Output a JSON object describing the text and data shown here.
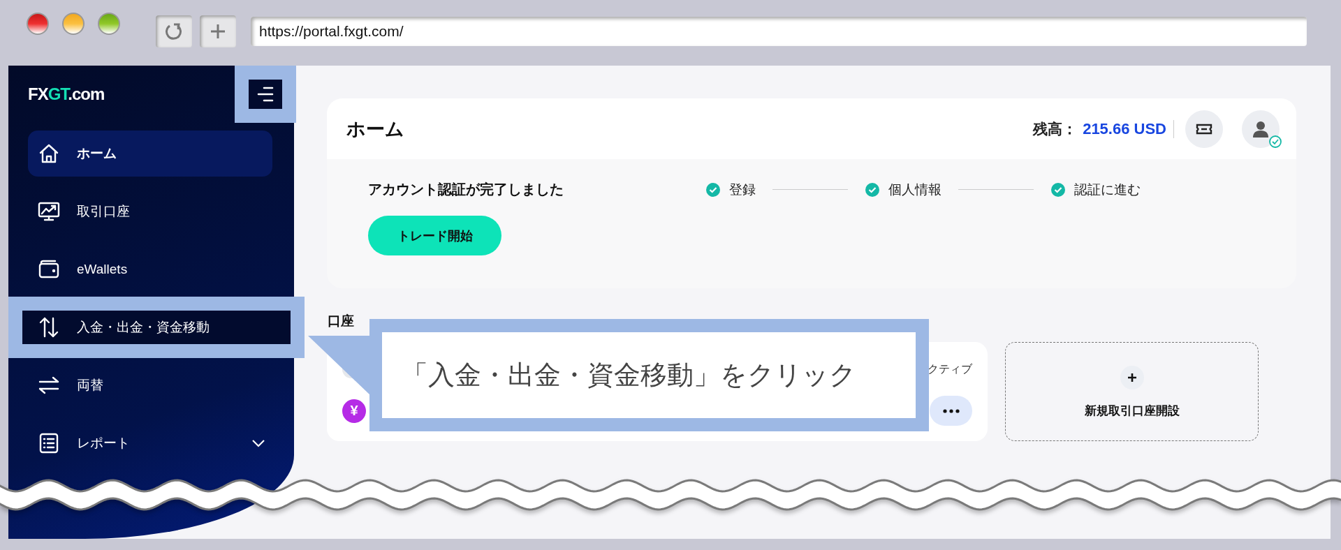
{
  "browser": {
    "url": "https://portal.fxgt.com/"
  },
  "sidebar": {
    "logo": [
      "FX",
      "GT",
      ".com"
    ],
    "menu_button": {
      "highlighted": true
    },
    "items": [
      {
        "label": "ホーム",
        "selected": true,
        "highlighted": false
      },
      {
        "label": "取引口座",
        "selected": false,
        "highlighted": false
      },
      {
        "label": "eWallets",
        "selected": false,
        "highlighted": false
      },
      {
        "label": "入金・出金・資金移動",
        "selected": false,
        "highlighted": true
      },
      {
        "label": "両替",
        "selected": false,
        "highlighted": false
      },
      {
        "label": "レポート",
        "selected": false,
        "highlighted": false,
        "expanded": false
      }
    ]
  },
  "header": {
    "title": "ホーム",
    "balance_label": "残高：",
    "balance_value": "215.66 USD"
  },
  "verification": {
    "message": "アカウント認証が完了しました",
    "steps": [
      {
        "label": "登録",
        "done": true
      },
      {
        "label": "個人情報",
        "done": true
      },
      {
        "label": "認証に進む",
        "done": true
      }
    ],
    "button": "トレード開始"
  },
  "accounts": {
    "heading": "口座",
    "status": "クティブ",
    "currency": "¥"
  },
  "new_account": {
    "label": "新規取引口座開設"
  },
  "callout": {
    "text": "「入金・出金・資金移動」をクリック"
  }
}
